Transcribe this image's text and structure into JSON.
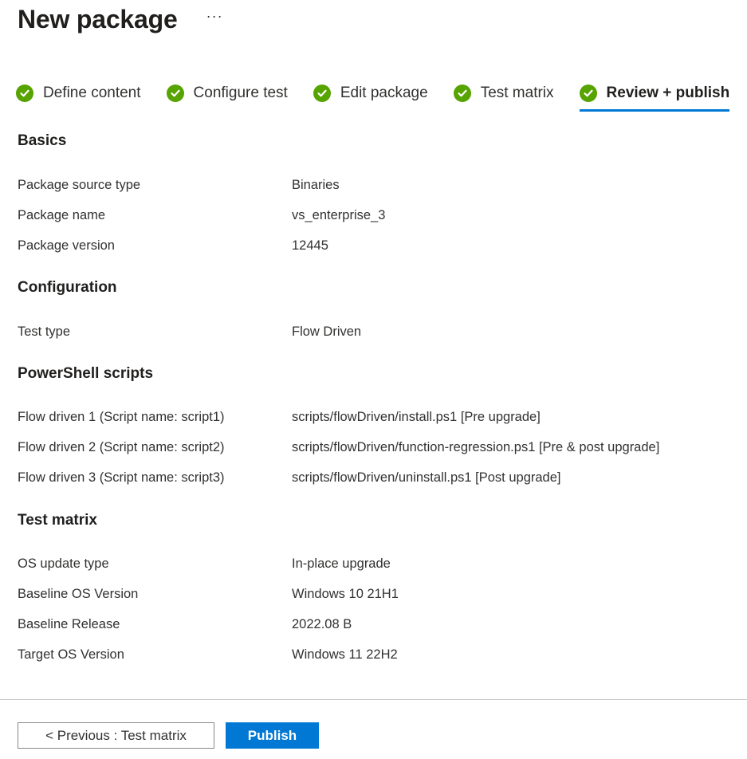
{
  "header": {
    "title": "New package",
    "more_label": "···"
  },
  "tabs": [
    {
      "label": "Define content",
      "icon": "check-circle-icon"
    },
    {
      "label": "Configure test",
      "icon": "check-circle-icon"
    },
    {
      "label": "Edit package",
      "icon": "check-circle-icon"
    },
    {
      "label": "Test matrix",
      "icon": "check-circle-icon"
    },
    {
      "label": "Review + publish",
      "icon": "check-circle-icon",
      "active": true
    }
  ],
  "basics": {
    "title": "Basics",
    "rows": [
      {
        "label": "Package source type",
        "value": "Binaries"
      },
      {
        "label": "Package name",
        "value": "vs_enterprise_3"
      },
      {
        "label": "Package version",
        "value": "12445"
      }
    ]
  },
  "configuration": {
    "title": "Configuration",
    "rows": [
      {
        "label": "Test type",
        "value": "Flow Driven"
      }
    ]
  },
  "powershell": {
    "title": "PowerShell scripts",
    "rows": [
      {
        "label": "Flow driven 1 (Script name: script1)",
        "value": "scripts/flowDriven/install.ps1 [Pre upgrade]"
      },
      {
        "label": "Flow driven 2 (Script name: script2)",
        "value": "scripts/flowDriven/function-regression.ps1 [Pre & post upgrade]"
      },
      {
        "label": "Flow driven 3 (Script name: script3)",
        "value": "scripts/flowDriven/uninstall.ps1 [Post upgrade]"
      }
    ]
  },
  "test_matrix": {
    "title": "Test matrix",
    "rows": [
      {
        "label": "OS update type",
        "value": "In-place upgrade"
      },
      {
        "label": "Baseline OS Version",
        "value": "Windows 10 21H1"
      },
      {
        "label": "Baseline Release",
        "value": "2022.08 B"
      },
      {
        "label": "Target OS Version",
        "value": "Windows 11 22H2"
      }
    ]
  },
  "footer": {
    "previous_label": "< Previous : Test matrix",
    "publish_label": "Publish"
  },
  "colors": {
    "accent": "#0078d4",
    "success": "#57a300",
    "text": "#323130"
  }
}
